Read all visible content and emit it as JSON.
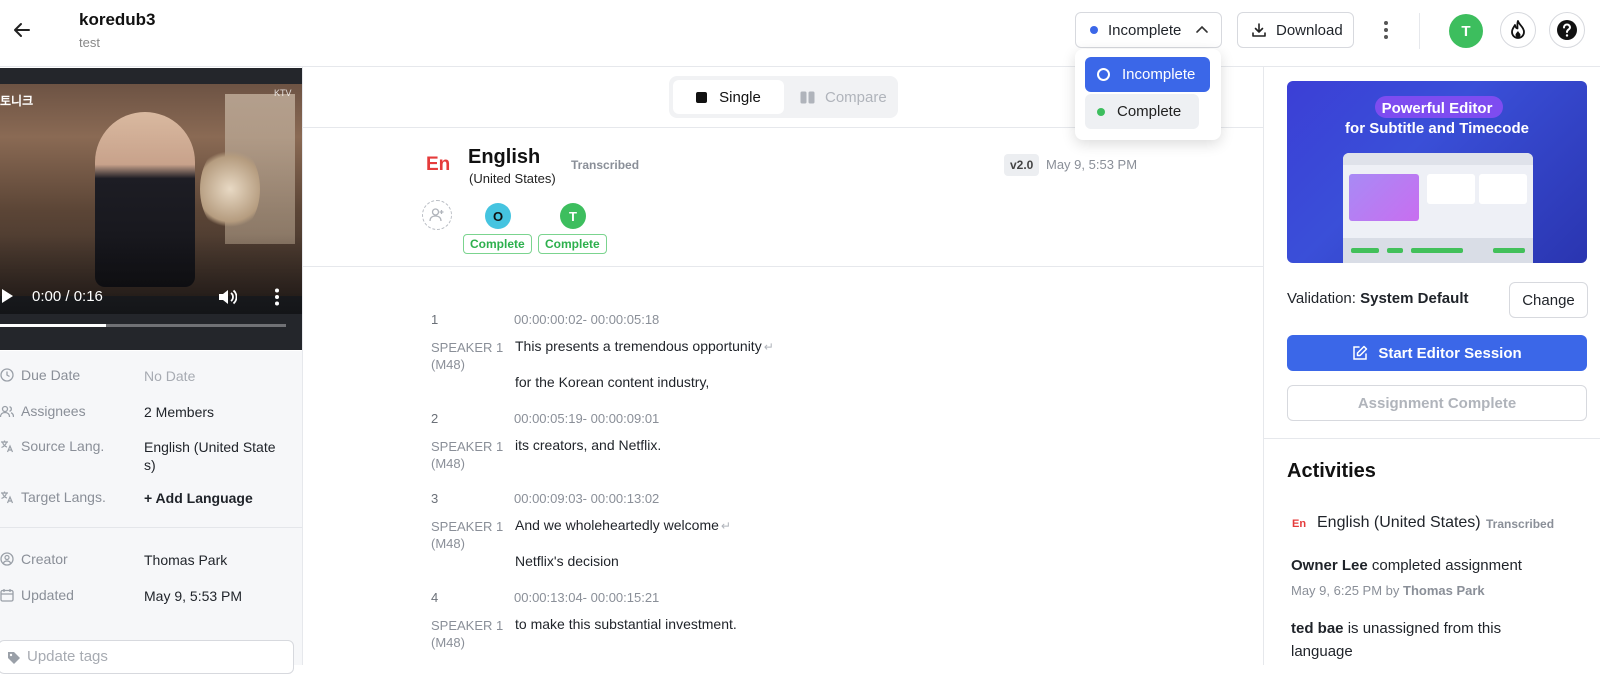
{
  "header": {
    "title": "koredub3",
    "subtitle": "test",
    "status_label": "Incomplete",
    "status_color": "#3b67e8",
    "download_label": "Download",
    "avatar_letter": "T",
    "avatar_color": "#3dbe5e"
  },
  "status_dropdown": {
    "options": [
      {
        "label": "Incomplete",
        "selected": true
      },
      {
        "label": "Complete",
        "selected": false,
        "color": "#3dbe5e"
      }
    ]
  },
  "video": {
    "time": "0:00 / 0:16",
    "progress": 0.37,
    "overlay_top_right": "KTV",
    "overlay_top_left": "토니크",
    "language_badge": "En"
  },
  "meta": {
    "due_date_label": "Due Date",
    "due_date_value": "No Date",
    "assignees_label": "Assignees",
    "assignees_value": "2 Members",
    "source_lang_label": "Source Lang.",
    "source_lang_value": "English (United State s)",
    "target_langs_label": "Target Langs.",
    "target_langs_value": "+ Add Language",
    "creator_label": "Creator",
    "creator_value": "Thomas Park",
    "updated_label": "Updated",
    "updated_value": "May 9, 5:53 PM",
    "tags_placeholder": "Update tags"
  },
  "view_toggle": {
    "single_label": "Single",
    "compare_label": "Compare"
  },
  "language": {
    "code": "En",
    "name": "English",
    "region": "(United States)",
    "status": "Transcribed",
    "version": "v2.0",
    "date": "May 9, 5:53 PM",
    "assignees": [
      {
        "initial": "O",
        "color": "#45c4e0",
        "status": "Complete"
      },
      {
        "initial": "T",
        "color": "#3dbe5e",
        "status": "Complete"
      }
    ]
  },
  "segments": [
    {
      "num": "1",
      "time": "00:00:00:02- 00:00:05:18",
      "speaker": "SPEAKER 1",
      "speaker_id": "(M48)",
      "lines": [
        "This presents a tremendous opportunity",
        "for the Korean content industry,"
      ]
    },
    {
      "num": "2",
      "time": "00:00:05:19- 00:00:09:01",
      "speaker": "SPEAKER 1",
      "speaker_id": "(M48)",
      "lines": [
        "its creators, and Netflix."
      ]
    },
    {
      "num": "3",
      "time": "00:00:09:03- 00:00:13:02",
      "speaker": "SPEAKER 1",
      "speaker_id": "(M48)",
      "lines": [
        "And we wholeheartedly welcome",
        "Netflix's decision"
      ]
    },
    {
      "num": "4",
      "time": "00:00:13:04- 00:00:15:21",
      "speaker": "SPEAKER 1",
      "speaker_id": "(M48)",
      "lines": [
        "to make this substantial investment."
      ]
    }
  ],
  "right_panel": {
    "promo_line1": "Powerful Editor",
    "promo_line2": "for Subtitle and Timecode",
    "validation_prefix": "Validation:",
    "validation_value": "System Default",
    "change_label": "Change",
    "start_editor_label": "Start Editor Session",
    "assignment_complete_label": "Assignment Complete",
    "activities_title": "Activities",
    "activity_lang_code": "En",
    "activity_lang_name": "English (United States)",
    "activity_lang_status": "Transcribed",
    "activity1_actor": "Owner Lee",
    "activity1_text": "completed assignment",
    "activity1_time": "May 9, 6:25 PM by",
    "activity1_by": "Thomas Park",
    "activity2_actor": "ted bae",
    "activity2_text": "is unassigned from this",
    "activity2_text2": "language"
  }
}
